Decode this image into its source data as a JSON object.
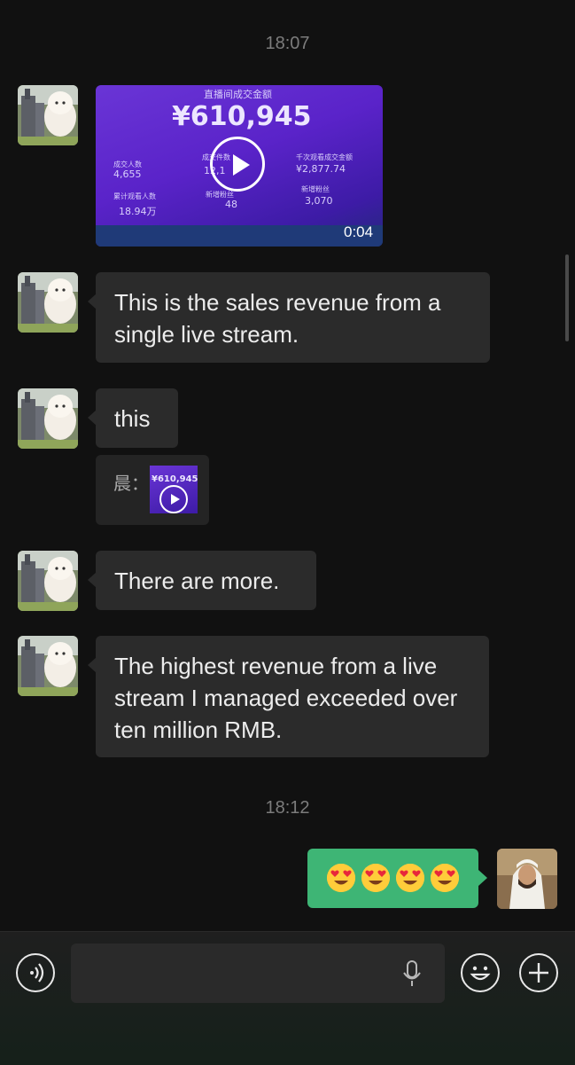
{
  "timestamps": [
    "18:07",
    "18:12"
  ],
  "video_message": {
    "title": "直播间成交金额",
    "amount": "¥610,945",
    "stats": [
      {
        "label": "成交人数",
        "value": "4,655"
      },
      {
        "label": "成交件数",
        "value": "12,1"
      },
      {
        "label": "千次观看成交金额",
        "value": "¥2,877.74"
      },
      {
        "label": "累计观看人数",
        "value": "18.94万"
      },
      {
        "label": "新增粉丝",
        "value": "48"
      },
      {
        "label": "新增粉丝",
        "value": "3,070"
      }
    ],
    "duration": "0:04"
  },
  "messages": [
    {
      "text": "This is the sales revenue from a single live stream."
    },
    {
      "text": "this"
    },
    {
      "text": "There are more."
    },
    {
      "text": "The highest revenue from a live stream I managed exceeded over ten million RMB."
    }
  ],
  "quote": {
    "sender": "晨：",
    "thumb_amount": "¥610,945"
  },
  "outgoing": {
    "emojis": [
      "😍",
      "😍",
      "😍",
      "😍"
    ]
  },
  "icons": {
    "voice": "voice-toggle-icon",
    "mic": "microphone-icon",
    "emoji": "emoji-icon",
    "plus": "plus-icon",
    "play": "play-icon"
  },
  "colors": {
    "background": "#111111",
    "bubble_incoming": "#2b2b2b",
    "bubble_outgoing": "#3eb575",
    "video_purple": "#5a23c9"
  }
}
